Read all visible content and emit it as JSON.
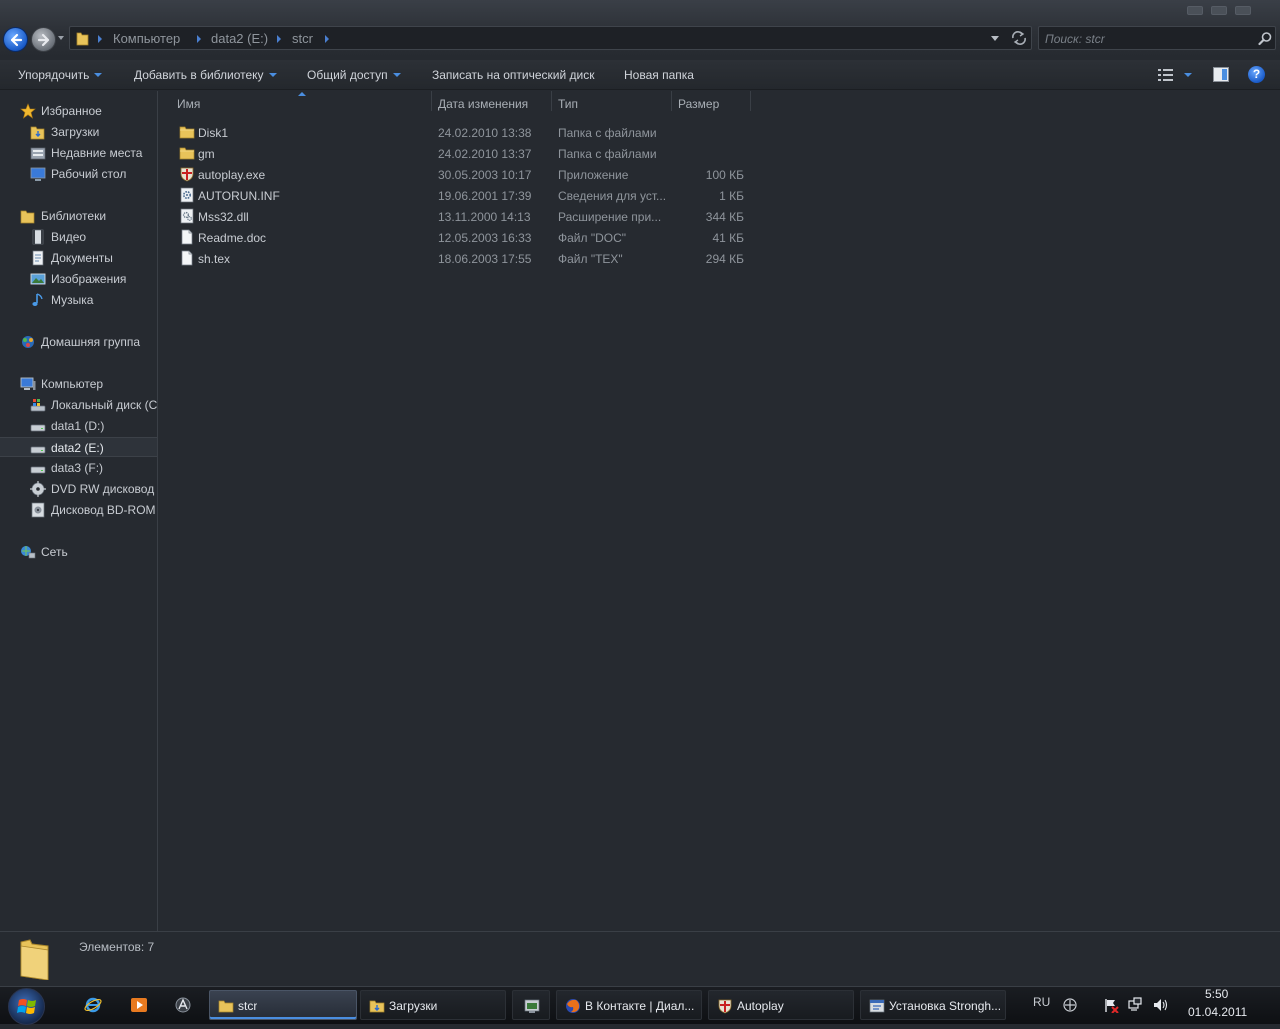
{
  "address": {
    "crumbs": [
      "Компьютер",
      "data2 (E:)",
      "stcr"
    ]
  },
  "search": {
    "placeholder": "Поиск: stcr"
  },
  "toolbar": {
    "organize": "Упорядочить",
    "add_library": "Добавить в библиотеку",
    "share": "Общий доступ",
    "burn": "Записать на оптический диск",
    "new_folder": "Новая папка",
    "help": "?"
  },
  "nav": {
    "favorites": "Избранное",
    "downloads": "Загрузки",
    "recent": "Недавние места",
    "desktop": "Рабочий стол",
    "libraries": "Библиотеки",
    "video": "Видео",
    "documents": "Документы",
    "images": "Изображения",
    "music": "Музыка",
    "homegroup": "Домашняя группа",
    "computer": "Компьютер",
    "local_c": "Локальный диск (C",
    "data1": "data1 (D:)",
    "data2": "data2 (E:)",
    "data3": "data3 (F:)",
    "dvd": "DVD RW дисковод (",
    "bd": "Дисковод BD-ROM",
    "network": "Сеть"
  },
  "columns": {
    "name": "Имя",
    "date": "Дата изменения",
    "type": "Тип",
    "size": "Размер"
  },
  "files": [
    {
      "name": "Disk1",
      "date": "24.02.2010 13:38",
      "type": "Папка с файлами",
      "size": "",
      "icon": "folder-icon"
    },
    {
      "name": "gm",
      "date": "24.02.2010 13:37",
      "type": "Папка с файлами",
      "size": "",
      "icon": "folder-icon"
    },
    {
      "name": "autoplay.exe",
      "date": "30.05.2003 10:17",
      "type": "Приложение",
      "size": "100 КБ",
      "icon": "shield-app-icon"
    },
    {
      "name": "AUTORUN.INF",
      "date": "19.06.2001 17:39",
      "type": "Сведения для уст...",
      "size": "1 КБ",
      "icon": "settings-file-icon"
    },
    {
      "name": "Mss32.dll",
      "date": "13.11.2000 14:13",
      "type": "Расширение при...",
      "size": "344 КБ",
      "icon": "dll-file-icon"
    },
    {
      "name": "Readme.doc",
      "date": "12.05.2003 16:33",
      "type": "Файл \"DOC\"",
      "size": "41 КБ",
      "icon": "document-icon"
    },
    {
      "name": "sh.tex",
      "date": "18.06.2003 17:55",
      "type": "Файл \"TEX\"",
      "size": "294 КБ",
      "icon": "document-icon"
    }
  ],
  "details": {
    "text": "Элементов: 7"
  },
  "taskbar": {
    "tasks": [
      "stcr",
      "Загрузки",
      "В Контакте | Диал...",
      "Autoplay",
      "Установка Strongh..."
    ],
    "lang": "RU",
    "time": "5:50",
    "date": "01.04.2011"
  },
  "colors": {
    "background": "#262a30",
    "accent": "#4a8ee0",
    "text": "#c8ccd2",
    "text_dim": "#8f959c"
  }
}
